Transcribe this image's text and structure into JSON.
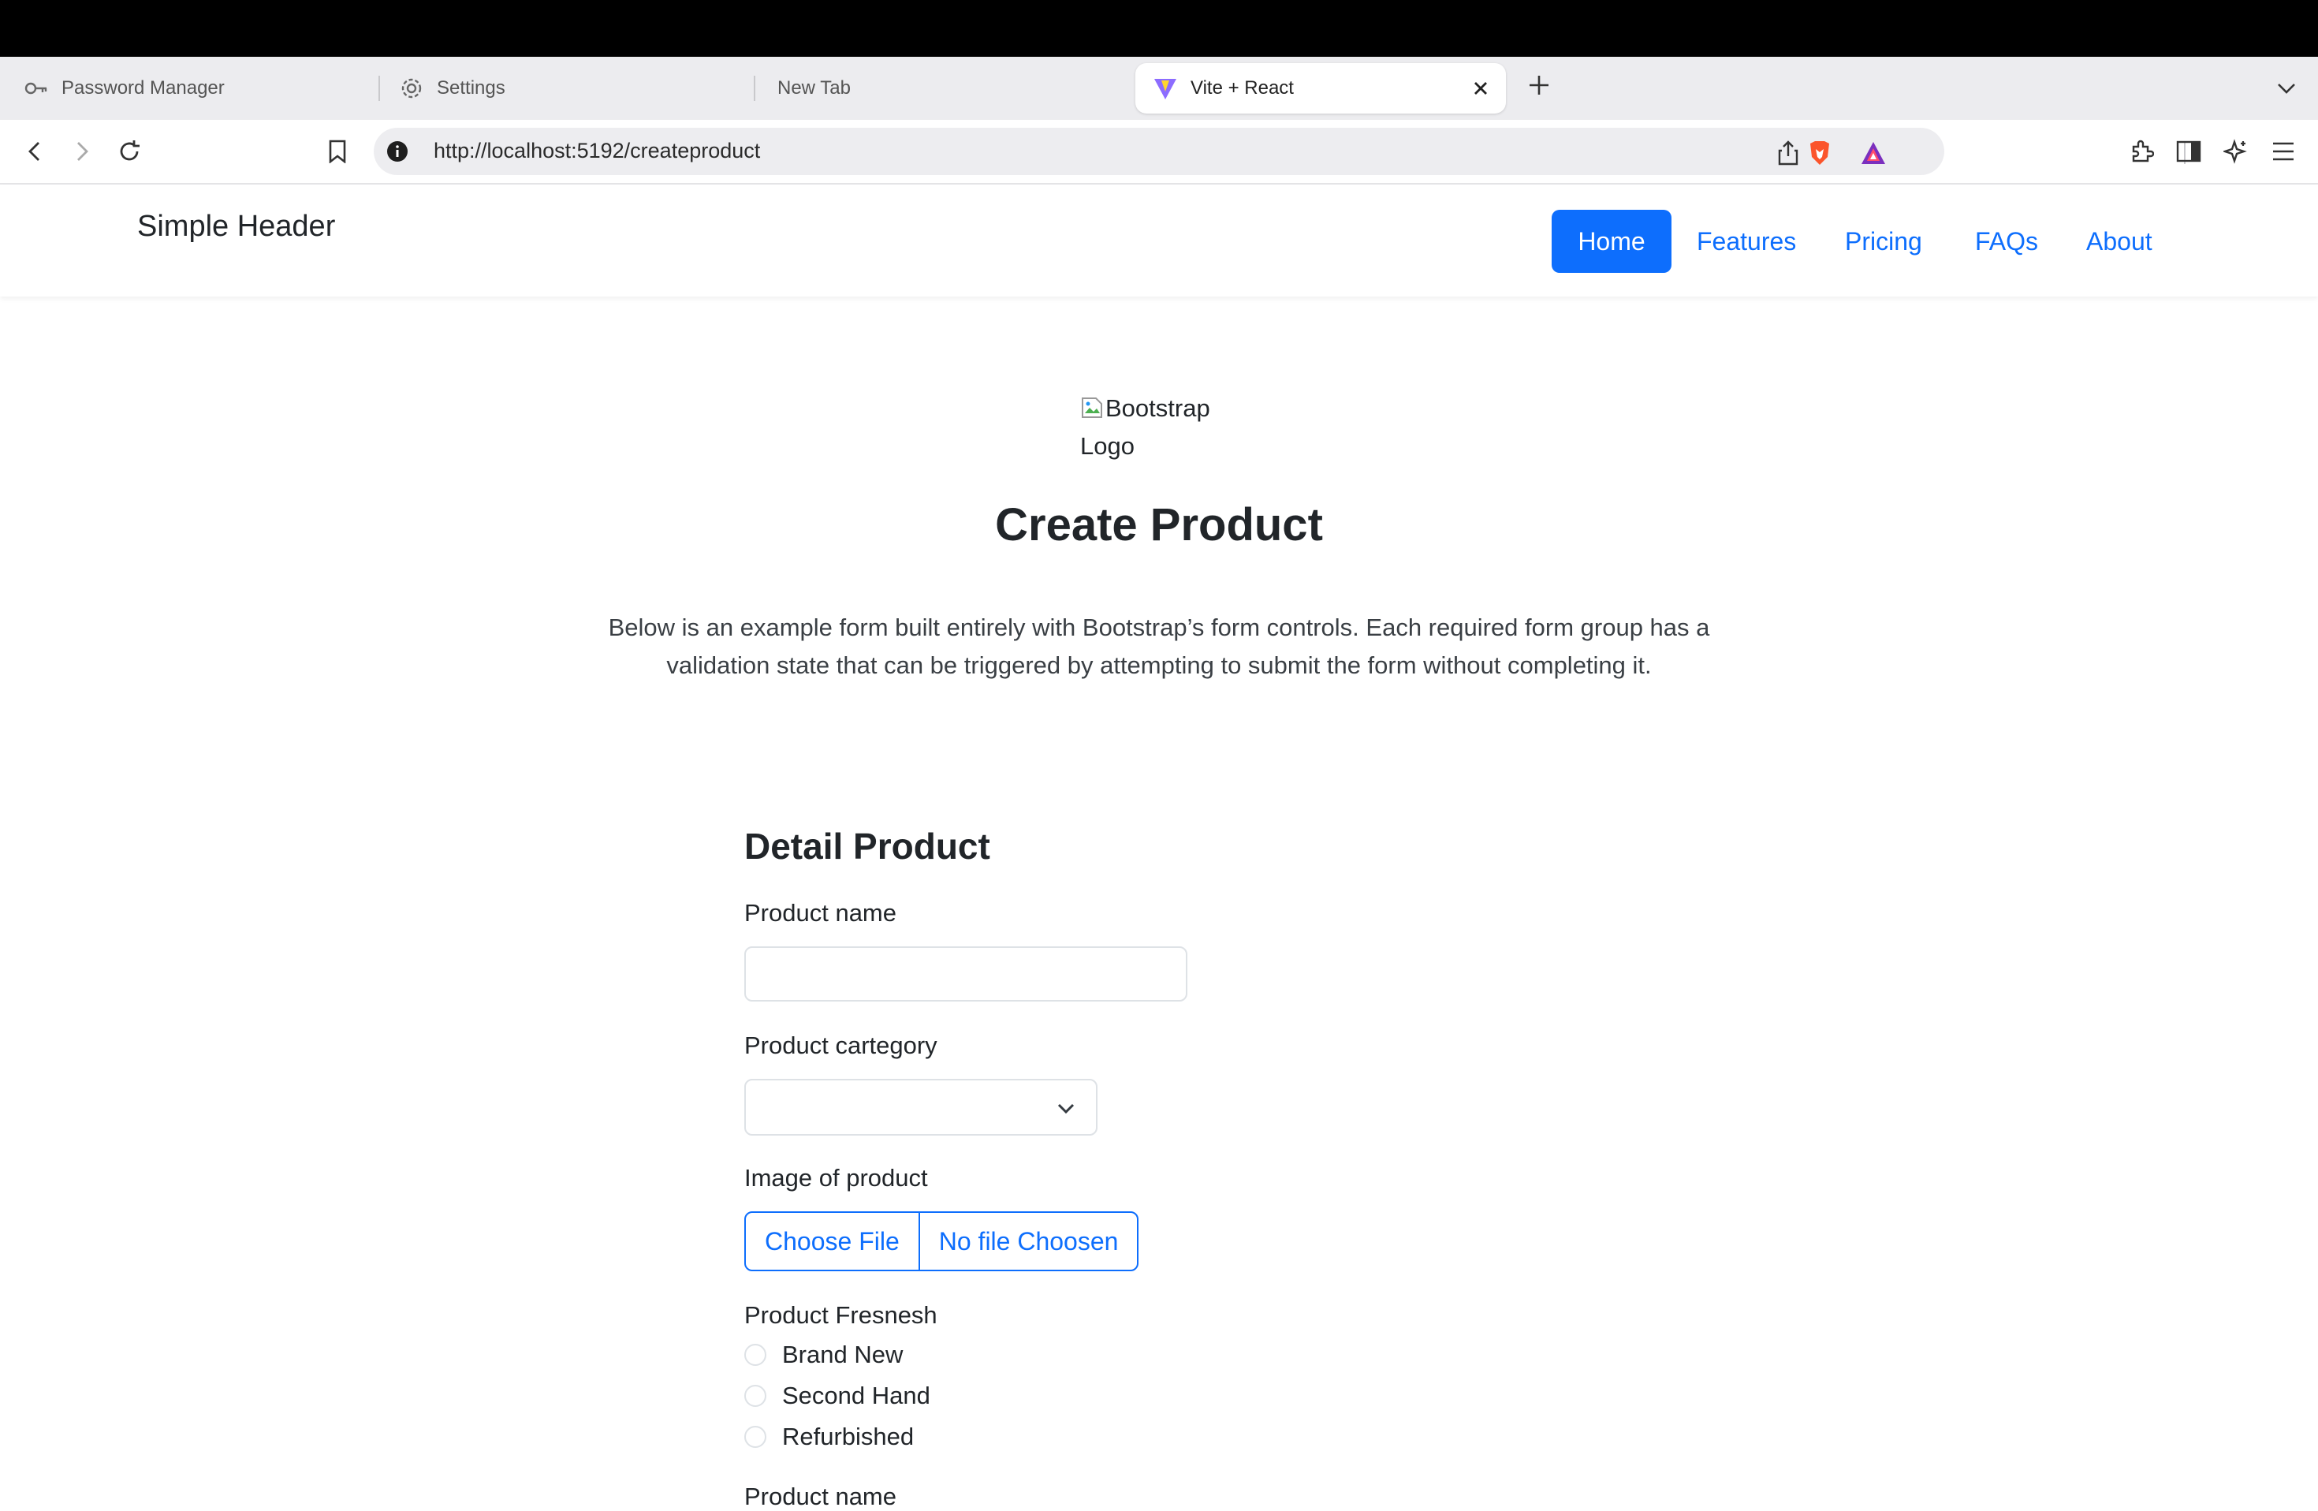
{
  "browser": {
    "tabs": [
      {
        "label": "Password Manager",
        "icon": "key-icon",
        "active": false
      },
      {
        "label": "Settings",
        "icon": "gear-icon",
        "active": false
      },
      {
        "label": "New Tab",
        "icon": "",
        "active": false
      },
      {
        "label": "Vite + React",
        "icon": "vite-logo-icon",
        "active": true
      }
    ],
    "url": "http://localhost:5192/createproduct"
  },
  "header": {
    "brand": "Simple Header",
    "nav": [
      {
        "label": "Home",
        "active": true
      },
      {
        "label": "Features",
        "active": false
      },
      {
        "label": "Pricing",
        "active": false
      },
      {
        "label": "FAQs",
        "active": false
      },
      {
        "label": "About",
        "active": false
      }
    ],
    "accent_color": "#0d6efd"
  },
  "hero": {
    "logo_alt_line1": "Bootstrap",
    "logo_alt_line2": "Logo",
    "title": "Create Product",
    "lead": "Below is an example form built entirely with Bootstrap’s form controls. Each required form group has a validation state that can be triggered by attempting to submit the form without completing it."
  },
  "form": {
    "section_title": "Detail Product",
    "product_name_label": "Product name",
    "product_name_value": "",
    "category_label": "Product cartegory",
    "category_value": "",
    "image_label": "Image of product",
    "choose_file_label": "Choose File",
    "no_file_label": "No file Choosen",
    "freshness_label": "Product Fresnesh",
    "freshness_options": [
      "Brand New",
      "Second Hand",
      "Refurbished"
    ],
    "product_name2_label": "Product name"
  }
}
